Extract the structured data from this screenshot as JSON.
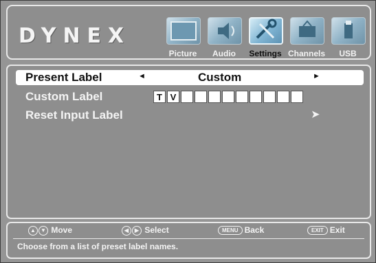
{
  "brand": "DYNEX",
  "tabs": [
    {
      "label": "Picture",
      "icon": "picture-icon",
      "active": false
    },
    {
      "label": "Audio",
      "icon": "audio-icon",
      "active": false
    },
    {
      "label": "Settings",
      "icon": "settings-icon",
      "active": true
    },
    {
      "label": "Channels",
      "icon": "channels-icon",
      "active": false
    },
    {
      "label": "USB",
      "icon": "usb-icon",
      "active": false
    }
  ],
  "menu": {
    "present_label": {
      "name": "Present Label",
      "value": "Custom",
      "left_arrow": "◄",
      "right_arrow": "►"
    },
    "custom_label": {
      "name": "Custom Label",
      "chars": [
        "T",
        "V",
        "",
        "",
        "",
        "",
        "",
        "",
        "",
        "",
        ""
      ]
    },
    "reset_input_label": {
      "name": "Reset Input Label",
      "chevron": "➤"
    }
  },
  "controls": {
    "move": "Move",
    "select": "Select",
    "menu_key": "MENU",
    "back": "Back",
    "exit_key": "EXIT",
    "exit": "Exit"
  },
  "help_text": "Choose from a list of preset label names.",
  "colors": {
    "background": "#959595",
    "highlight": "#ffffff",
    "text": "#f4f4f4"
  }
}
